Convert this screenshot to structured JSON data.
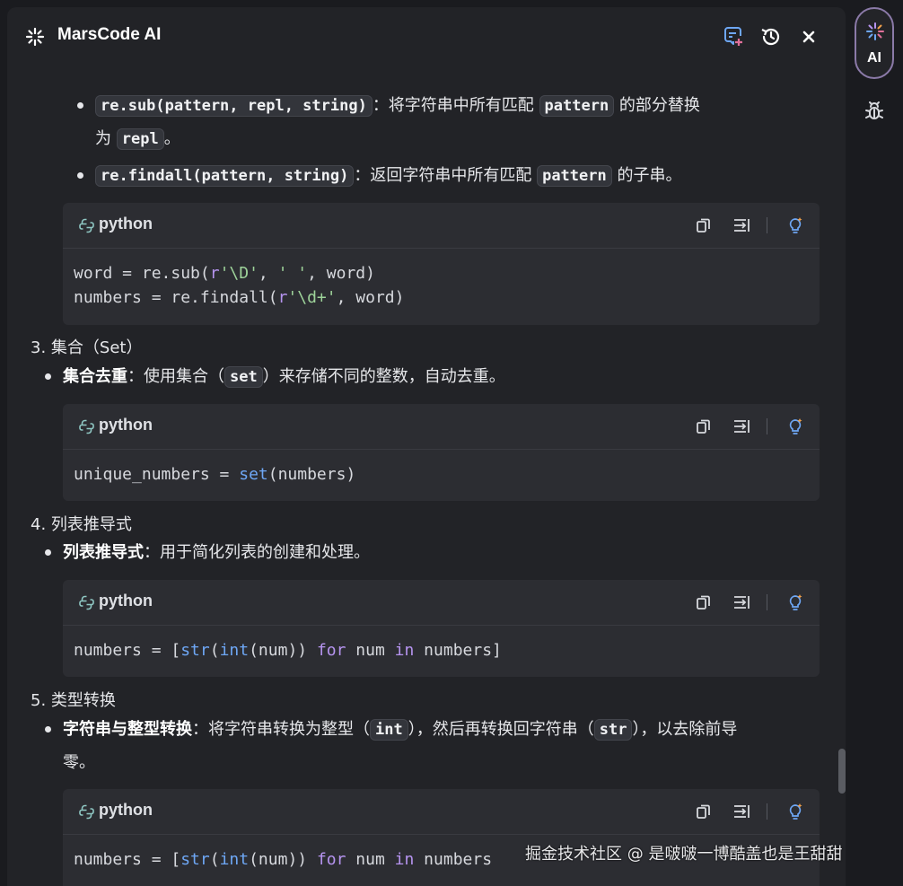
{
  "header": {
    "title": "MarsCode AI"
  },
  "icons": {
    "logo": "sparkle-icon",
    "new_chat": "new-chat-icon",
    "history": "history-icon",
    "close": "close-icon",
    "lang": "python-icon",
    "copy": "copy-icon",
    "insert": "insert-icon",
    "explain": "lightbulb-icon",
    "bug": "bug-icon"
  },
  "content": {
    "b1": {
      "code": "re.sub(pattern, repl, string)",
      "t1": "：将字符串中所有匹配 ",
      "code2": "pattern",
      "t2": " 的部分替换",
      "t3": "为 ",
      "code3": "repl",
      "t4": "。"
    },
    "b2": {
      "code": "re.findall(pattern, string)",
      "t1": "：返回字符串中所有匹配 ",
      "code2": "pattern",
      "t2": " 的子串。"
    },
    "block1": {
      "lang": "python"
    },
    "h3": "3. 集合（Set）",
    "b3": {
      "bold": "集合去重",
      "t1": "：使用集合（",
      "code": "set",
      "t2": "）来存储不同的整数，自动去重。"
    },
    "block2": {
      "lang": "python"
    },
    "h4": "4. 列表推导式",
    "b4": {
      "bold": "列表推导式",
      "t1": "：用于简化列表的创建和处理。"
    },
    "block3": {
      "lang": "python"
    },
    "h5": "5. 类型转换",
    "b5": {
      "bold": "字符串与整型转换",
      "t1": "：将字符串转换为整型（",
      "code": "int",
      "t2": "），然后再转换回字符串（",
      "code2": "str",
      "t3": "），以去除前导",
      "t4": "零。"
    },
    "block4": {
      "lang": "python"
    }
  },
  "sidebar": {
    "ai_label": "AI"
  },
  "watermark": "掘金技术社区 @ 是啵啵一博酷盖也是王甜甜"
}
